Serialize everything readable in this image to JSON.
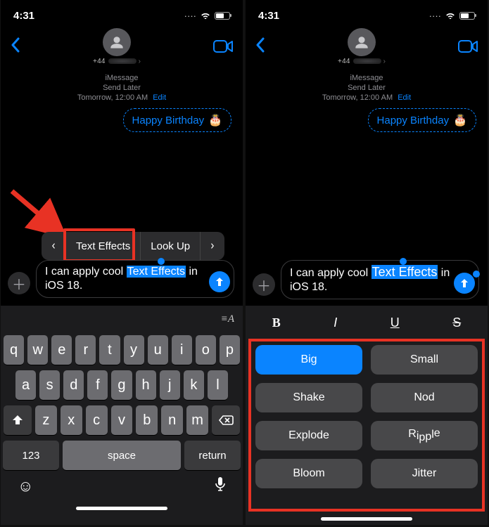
{
  "status": {
    "time": "4:31",
    "ellipsis": "····"
  },
  "header": {
    "contact_prefix": "+44"
  },
  "meta": {
    "service": "iMessage",
    "mode": "Send Later",
    "when": "Tomorrow, 12:00 AM",
    "edit": "Edit"
  },
  "scheduled_bubble": {
    "text": "Happy Birthday",
    "emoji": "🎂"
  },
  "compose": {
    "before": "I  can apply cool ",
    "selected": "Text Effects",
    "after_1": " in",
    "line2": "iOS 18."
  },
  "context_menu": {
    "item1": "Text Effects",
    "item2": "Look Up"
  },
  "keyboard": {
    "rows": [
      [
        "q",
        "w",
        "e",
        "r",
        "t",
        "y",
        "u",
        "i",
        "o",
        "p"
      ],
      [
        "a",
        "s",
        "d",
        "f",
        "g",
        "h",
        "j",
        "k",
        "l"
      ],
      [
        "z",
        "x",
        "c",
        "v",
        "b",
        "n",
        "m"
      ]
    ],
    "num": "123",
    "space": "space",
    "ret": "return"
  },
  "effects": {
    "styles": {
      "bold": "B",
      "italic": "I",
      "underline": "U",
      "strike": "S"
    },
    "buttons": [
      "Big",
      "Small",
      "Shake",
      "Nod",
      "Explode",
      "Ripple",
      "Bloom",
      "Jitter"
    ],
    "active": "Big"
  }
}
